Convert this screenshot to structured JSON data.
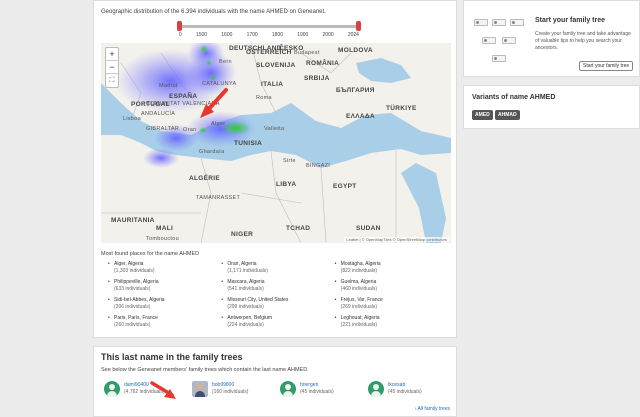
{
  "intro_text": "Geographic distribution of the 6.394 individuals with the name AHMED on Geneanet.",
  "slider": {
    "ticks": [
      "0",
      "1500",
      "1600",
      "1700",
      "1800",
      "1900",
      "2000",
      "2024"
    ]
  },
  "map": {
    "zoom_in": "+",
    "zoom_out": "−",
    "fullscreen": "⛶",
    "labels": {
      "deutschland": "DEUTSCHLAND",
      "cesko": "ČESKO",
      "osterreich": "ÖSTERREICH",
      "budapest": "Budapest",
      "romania": "ROMÂNIA",
      "moldova": "MOLDOVA",
      "bern": "Bern",
      "slovenija": "SLOVENIJA",
      "srbija": "SRBIJA",
      "portugal": "PORTUGAL",
      "espana": "ESPAÑA",
      "italia": "ITALIA",
      "madrid": "Madrid",
      "roma": "Roma",
      "lisboa": "Lisboa",
      "bulgaria": "БЪЛГАРИЯ",
      "turkiye": "TÜRKIYE",
      "ellada": "ΕΛΛΑΔΑ",
      "cat": "CATALUNYA",
      "valenciana": "COMUNITAT VALENCIANA",
      "andalucia": "ANDALUCÍA",
      "gibraltar": "GIBRALTAR",
      "oran": "Oran",
      "valletta": "Valletta",
      "tunisia": "TUNISIA",
      "alger": "Alger",
      "ghardaia": "Ghardaïa",
      "algerie": "ALGÉRIE",
      "libya": "LIBYA",
      "egypt": "EGYPT",
      "tamanrasset": "TAMANRASSET",
      "mauritania": "MAURITANIA",
      "mali": "MALI",
      "niger": "NIGER",
      "tchad": "TCHAD",
      "tombouctou": "Tombouctou",
      "sudan": "SUDAN",
      "sirte": "Sirte",
      "bingazi": "BINGAZI"
    },
    "attribution": "Leaflet | © OpenMapTiles © OpenStreetMap contributors"
  },
  "places_title": "Most found places for the name AHMED",
  "places": [
    {
      "name": "Alger, Algeria",
      "count": "(1,303 individuals)"
    },
    {
      "name": "Oran, Algeria",
      "count": "(1,171 individuals)"
    },
    {
      "name": "Mostagha, Algeria",
      "count": "(822 individuals)"
    },
    {
      "name": "Philippeville, Algeria",
      "count": "(633 individuals)"
    },
    {
      "name": "Mascara, Algeria",
      "count": "(541 individuals)"
    },
    {
      "name": "Guelma, Algeria",
      "count": "(460 individuals)"
    },
    {
      "name": "Sidi-bel-Abbes, Algeria",
      "count": "(306 individuals)"
    },
    {
      "name": "Missouri City, United States",
      "count": "(299 individuals)"
    },
    {
      "name": "Fréjus, Var, France",
      "count": "(269 individuals)"
    },
    {
      "name": "Paris, Paris, France",
      "count": "(260 individuals)"
    },
    {
      "name": "Antwerpen, Belgium",
      "count": "(224 individuals)"
    },
    {
      "name": "Leghouat, Algeria",
      "count": "(221 individuals)"
    }
  ],
  "trees": {
    "title": "This last name in the family trees",
    "desc": "See below the Geneanet members' family trees which contain the last name AHMED.",
    "items": [
      {
        "user": "dami90400",
        "count": "(4,762 individuals)"
      },
      {
        "user": "bob99800",
        "count": "(160 individuals)"
      },
      {
        "user": "hnergen",
        "count": "(45 individuals)"
      },
      {
        "user": "tkoxsab",
        "count": "(45 individuals)"
      }
    ],
    "all_link": "All family trees"
  },
  "sidebar": {
    "start_title": "Start your family tree",
    "start_desc": "Create your family tree and take advantage of valuable tips to help you search your ancestors.",
    "start_button": "Start your family tree",
    "variants_title": "Variants of name AHMED",
    "variants": [
      "AMED",
      "AHMAD"
    ]
  },
  "colors": {
    "accent": "#2a6db0",
    "avatar": "#2e9c6b",
    "arrow": "#e8382e",
    "heat_blue": "#6b6bff",
    "heat_green": "#3ad33a"
  }
}
